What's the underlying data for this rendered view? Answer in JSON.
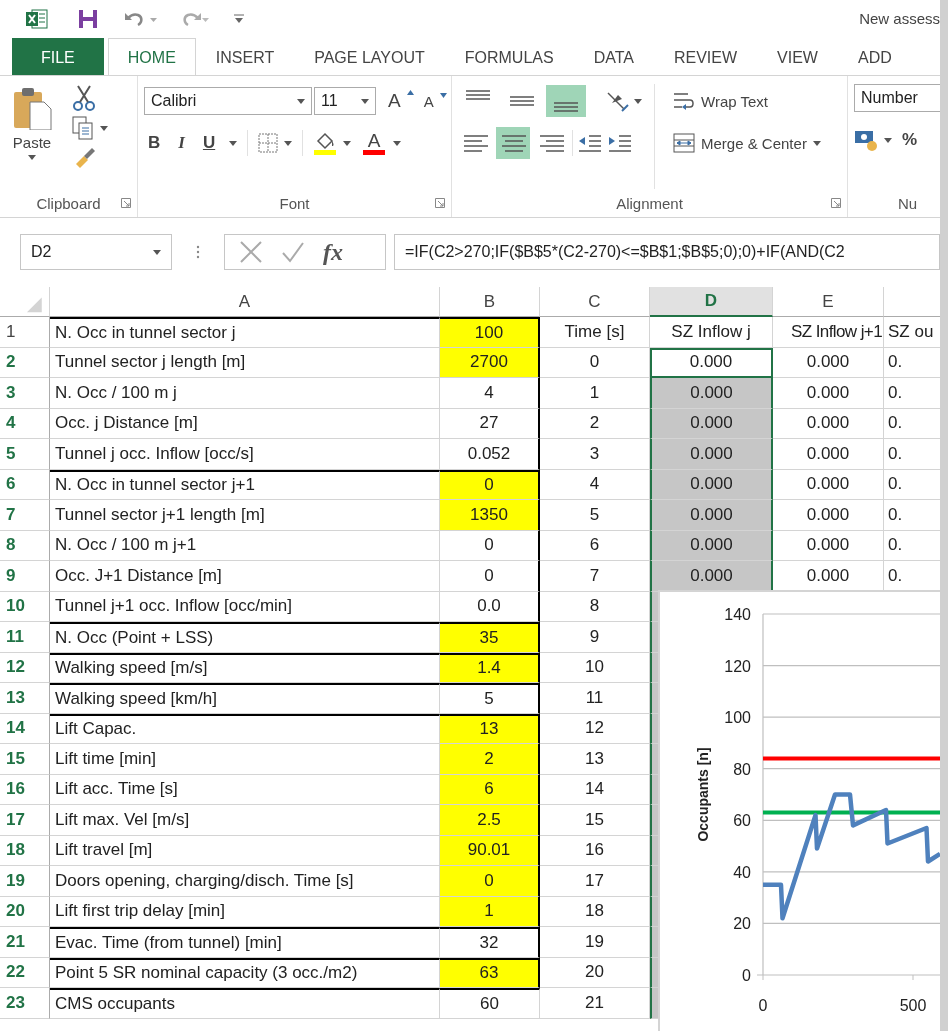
{
  "window": {
    "title": "New assess"
  },
  "ribbon_tabs": [
    {
      "label": "FILE",
      "kind": "file",
      "selected": false
    },
    {
      "label": "HOME",
      "kind": "tab",
      "selected": true
    },
    {
      "label": "INSERT",
      "kind": "tab",
      "selected": false
    },
    {
      "label": "PAGE LAYOUT",
      "kind": "tab",
      "selected": false
    },
    {
      "label": "FORMULAS",
      "kind": "tab",
      "selected": false
    },
    {
      "label": "DATA",
      "kind": "tab",
      "selected": false
    },
    {
      "label": "REVIEW",
      "kind": "tab",
      "selected": false
    },
    {
      "label": "VIEW",
      "kind": "tab",
      "selected": false
    },
    {
      "label": "ADD",
      "kind": "tab",
      "selected": false
    }
  ],
  "clipboard": {
    "paste": "Paste",
    "group": "Clipboard"
  },
  "font": {
    "name": "Calibri",
    "size": "11",
    "grow": "A",
    "shrink": "A",
    "bold": "B",
    "italic": "I",
    "underline": "U",
    "color_letter": "A",
    "group": "Font"
  },
  "alignment": {
    "vertical": [
      {
        "selected": false
      },
      {
        "selected": false
      },
      {
        "selected": true
      }
    ],
    "horizontal": [
      {
        "selected": false
      },
      {
        "selected": true
      },
      {
        "selected": false
      }
    ],
    "wrap_text": "Wrap Text",
    "merge": "Merge & Center",
    "group": "Alignment"
  },
  "number": {
    "format": "Number",
    "percent": "%",
    "group": "Nu"
  },
  "formula_bar": {
    "name_box": "D2",
    "fx": "fx",
    "formula": "=IF(C2>270;IF($B$5*(C2-270)<=$B$1;$B$5;0);0)+IF(AND(C2"
  },
  "sheet": {
    "columns": [
      {
        "label": "A",
        "selected": false
      },
      {
        "label": "B",
        "selected": false
      },
      {
        "label": "C",
        "selected": false
      },
      {
        "label": "D",
        "selected": true
      },
      {
        "label": "E",
        "selected": false
      }
    ],
    "rows": [
      {
        "number": "1",
        "selected": false,
        "group_start": true,
        "input": true,
        "d_selected": false,
        "d_active": false,
        "cells": [
          "N. Occ in tunnel sector j",
          "100",
          "Time [s]",
          "SZ Inflow j",
          "SZ Inflow j+1",
          "SZ ou"
        ]
      },
      {
        "number": "2",
        "selected": true,
        "group_start": false,
        "input": true,
        "d_selected": true,
        "d_active": true,
        "cells": [
          "Tunnel sector j length [m]",
          "2700",
          "0",
          "0.000",
          "0.000",
          "0."
        ]
      },
      {
        "number": "3",
        "selected": true,
        "group_start": false,
        "input": false,
        "d_selected": true,
        "d_active": false,
        "cells": [
          "N. Occ / 100 m j",
          "4",
          "1",
          "0.000",
          "0.000",
          "0."
        ]
      },
      {
        "number": "4",
        "selected": true,
        "group_start": false,
        "input": false,
        "d_selected": true,
        "d_active": false,
        "cells": [
          "Occ. j Distance [m]",
          "27",
          "2",
          "0.000",
          "0.000",
          "0."
        ]
      },
      {
        "number": "5",
        "selected": true,
        "group_start": false,
        "input": false,
        "d_selected": true,
        "d_active": false,
        "cells": [
          "Tunnel j occ. Inflow [occ/s]",
          "0.052",
          "3",
          "0.000",
          "0.000",
          "0."
        ]
      },
      {
        "number": "6",
        "selected": true,
        "group_start": true,
        "input": true,
        "d_selected": true,
        "d_active": false,
        "cells": [
          "N. Occ in tunnel sector j+1",
          "0",
          "4",
          "0.000",
          "0.000",
          "0."
        ]
      },
      {
        "number": "7",
        "selected": true,
        "group_start": false,
        "input": true,
        "d_selected": true,
        "d_active": false,
        "cells": [
          "Tunnel sector j+1 length [m]",
          "1350",
          "5",
          "0.000",
          "0.000",
          "0."
        ]
      },
      {
        "number": "8",
        "selected": true,
        "group_start": false,
        "input": false,
        "d_selected": true,
        "d_active": false,
        "cells": [
          "N. Occ / 100 m j+1",
          "0",
          "6",
          "0.000",
          "0.000",
          "0."
        ]
      },
      {
        "number": "9",
        "selected": true,
        "group_start": false,
        "input": false,
        "d_selected": true,
        "d_active": false,
        "cells": [
          "Occ. J+1 Distance [m]",
          "0",
          "7",
          "0.000",
          "0.000",
          "0."
        ]
      },
      {
        "number": "10",
        "selected": true,
        "group_start": false,
        "input": false,
        "d_selected": true,
        "d_active": false,
        "cells": [
          "Tunnel j+1 occ. Inflow [occ/min]",
          "0.0",
          "8"
        ]
      },
      {
        "number": "11",
        "selected": true,
        "group_start": true,
        "input": true,
        "d_selected": true,
        "d_active": false,
        "cells": [
          "N. Occ (Point + LSS)",
          "35",
          "9"
        ]
      },
      {
        "number": "12",
        "selected": true,
        "group_start": true,
        "input": true,
        "d_selected": true,
        "d_active": false,
        "cells": [
          "Walking speed [m/s]",
          "1.4",
          "10"
        ]
      },
      {
        "number": "13",
        "selected": true,
        "group_start": true,
        "input": false,
        "d_selected": true,
        "d_active": false,
        "cells": [
          "Walking speed [km/h]",
          "5",
          "11"
        ]
      },
      {
        "number": "14",
        "selected": true,
        "group_start": true,
        "input": true,
        "d_selected": true,
        "d_active": false,
        "cells": [
          "Lift Capac.",
          "13",
          "12"
        ]
      },
      {
        "number": "15",
        "selected": true,
        "group_start": false,
        "input": true,
        "d_selected": true,
        "d_active": false,
        "cells": [
          "Lift time [min]",
          "2",
          "13"
        ]
      },
      {
        "number": "16",
        "selected": true,
        "group_start": false,
        "input": true,
        "d_selected": true,
        "d_active": false,
        "cells": [
          "Lift acc. Time [s]",
          "6",
          "14"
        ]
      },
      {
        "number": "17",
        "selected": true,
        "group_start": false,
        "input": true,
        "d_selected": true,
        "d_active": false,
        "cells": [
          "Lift max. Vel [m/s]",
          "2.5",
          "15"
        ]
      },
      {
        "number": "18",
        "selected": true,
        "group_start": false,
        "input": true,
        "d_selected": true,
        "d_active": false,
        "cells": [
          "Lift travel [m]",
          "90.01",
          "16"
        ]
      },
      {
        "number": "19",
        "selected": true,
        "group_start": false,
        "input": true,
        "d_selected": true,
        "d_active": false,
        "cells": [
          "Doors opening, charging/disch. Time [s]",
          "0",
          "17"
        ]
      },
      {
        "number": "20",
        "selected": true,
        "group_start": false,
        "input": true,
        "d_selected": true,
        "d_active": false,
        "cells": [
          "Lift first trip delay [min]",
          "1",
          "18"
        ]
      },
      {
        "number": "21",
        "selected": true,
        "group_start": true,
        "input": false,
        "d_selected": true,
        "d_active": false,
        "cells": [
          "Evac. Time (from tunnel) [min]",
          "32",
          "19"
        ]
      },
      {
        "number": "22",
        "selected": true,
        "group_start": true,
        "input": true,
        "d_selected": true,
        "d_active": false,
        "cells": [
          "Point 5 SR nominal capacity (3 occ./m2)",
          "63",
          "20"
        ]
      },
      {
        "number": "23",
        "selected": true,
        "group_start": true,
        "input": false,
        "d_selected": true,
        "d_active": false,
        "cells": [
          "CMS occupants",
          "60",
          "21"
        ]
      }
    ]
  },
  "chart": {
    "chart_data": {
      "type": "line",
      "ylabel": "Occupants [n]",
      "x": [
        0,
        60,
        65,
        175,
        180,
        240,
        290,
        300,
        410,
        415,
        545,
        550,
        590
      ],
      "series": [
        {
          "color": "#4f81bd",
          "values": [
            35,
            35,
            22,
            62,
            49,
            70,
            70,
            58,
            64,
            51,
            57,
            44,
            47
          ]
        },
        {
          "color": "#ff0000",
          "values": [
            84,
            84,
            84,
            84,
            84,
            84,
            84,
            84,
            84,
            84,
            84,
            84,
            84
          ]
        },
        {
          "color": "#00b050",
          "values": [
            63,
            63,
            63,
            63,
            63,
            63,
            63,
            63,
            63,
            63,
            63,
            63,
            63
          ]
        }
      ],
      "xlim": [
        0,
        650
      ],
      "grid": true,
      "ylim": [
        0,
        140
      ],
      "yticks": [
        0,
        20,
        40,
        60,
        80,
        100,
        120,
        140
      ],
      "xticks": [
        0,
        500
      ]
    }
  }
}
